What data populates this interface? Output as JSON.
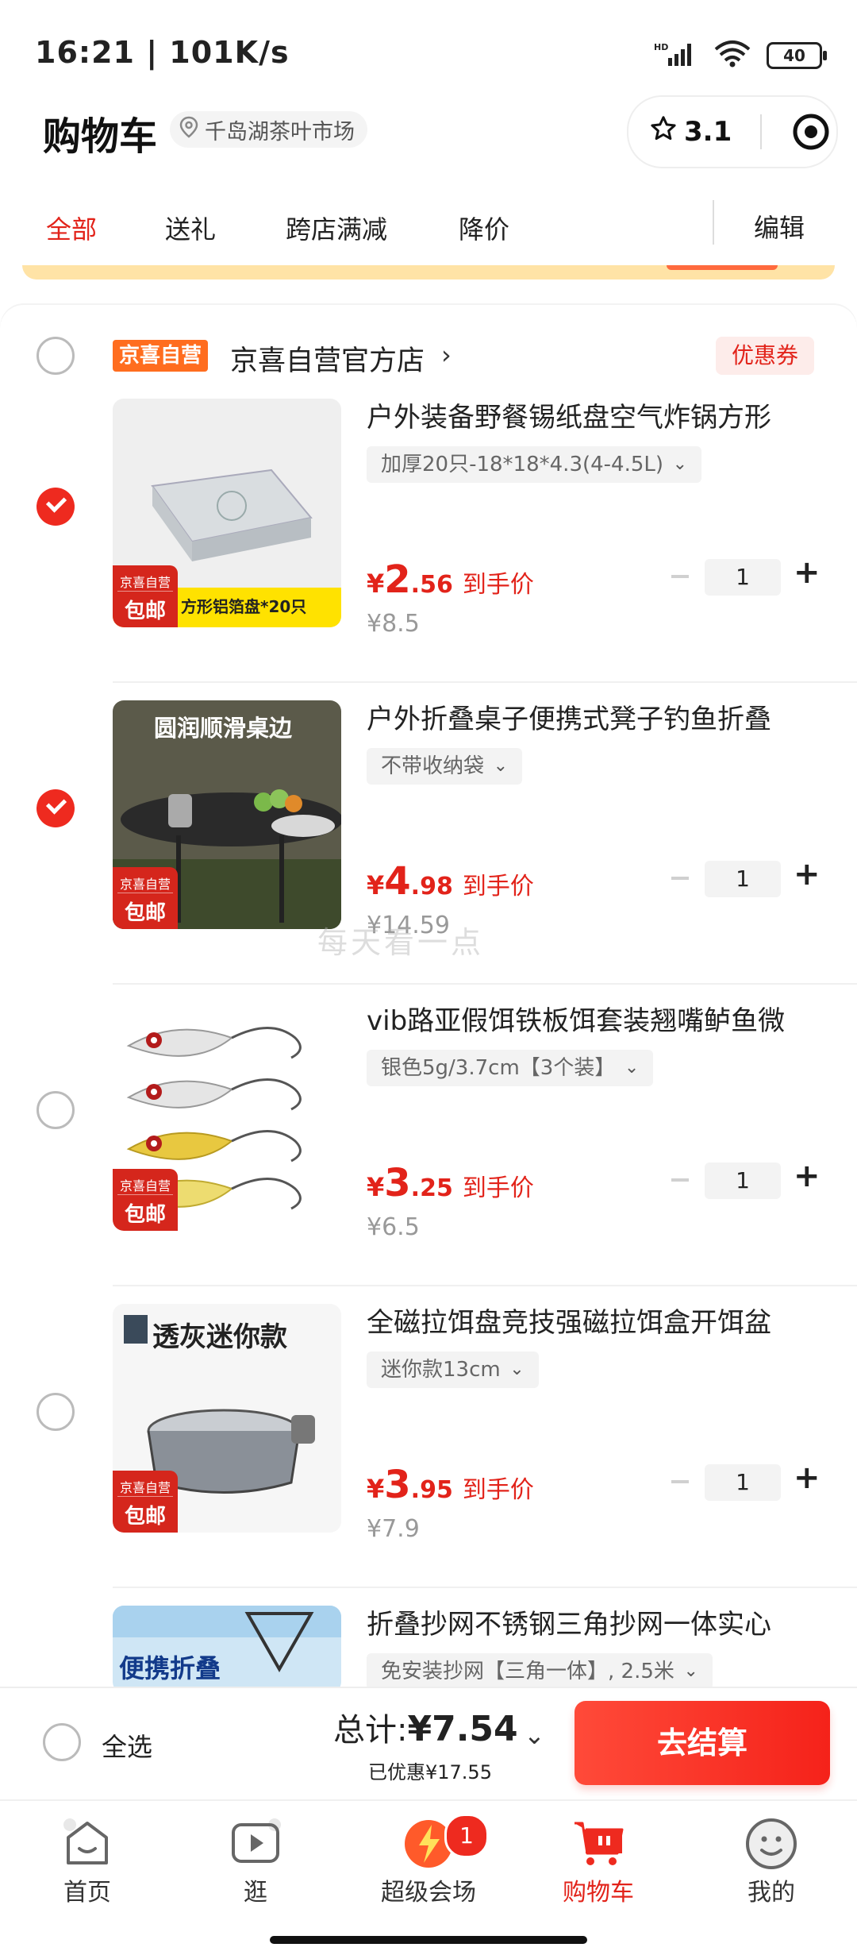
{
  "status_bar": {
    "time": "16:21 | 101K/s",
    "battery": "40"
  },
  "header": {
    "title": "购物车",
    "location": "千岛湖茶叶市场",
    "rating": "3.1"
  },
  "tabs": [
    {
      "label": "全部",
      "active": true
    },
    {
      "label": "送礼",
      "active": false
    },
    {
      "label": "跨店满减",
      "active": false
    },
    {
      "label": "降价",
      "active": false
    }
  ],
  "edit_label": "编辑",
  "shop": {
    "tag": "京喜自营",
    "name": "京喜自营官方店",
    "arrow": "›",
    "coupon_label": "优惠券"
  },
  "badge": {
    "line1": "京喜自营",
    "line2": "包邮"
  },
  "items": [
    {
      "checked": true,
      "title": "户外装备野餐锡纸盘空气炸锅方形",
      "spec": "加厚20只-18*18*4.3(4-4.5L)",
      "currency": "¥",
      "price_int": "2",
      "price_dec": ".56",
      "price_label": "到手价",
      "original_price": "¥8.5",
      "qty": "1",
      "thumb_text": "方形铝箔盘*20只"
    },
    {
      "checked": true,
      "title": "户外折叠桌子便携式凳子钓鱼折叠",
      "spec": "不带收纳袋",
      "currency": "¥",
      "price_int": "4",
      "price_dec": ".98",
      "price_label": "到手价",
      "original_price": "¥14.59",
      "qty": "1",
      "thumb_text": "圆润顺滑桌边"
    },
    {
      "checked": false,
      "title": "vib路亚假饵铁板饵套装翘嘴鲈鱼微",
      "spec": "银色5g/3.7cm【3个装】",
      "currency": "¥",
      "price_int": "3",
      "price_dec": ".25",
      "price_label": "到手价",
      "original_price": "¥6.5",
      "qty": "1",
      "thumb_text": ""
    },
    {
      "checked": false,
      "title": "全磁拉饵盘竞技强磁拉饵盒开饵盆",
      "spec": "迷你款13cm",
      "currency": "¥",
      "price_int": "3",
      "price_dec": ".95",
      "price_label": "到手价",
      "original_price": "¥7.9",
      "qty": "1",
      "thumb_text": "透灰迷你款"
    },
    {
      "checked": false,
      "title": "折叠抄网不锈钢三角抄网一体实心",
      "spec": "免安装抄网【三角一体】, 2.5米",
      "thumb_text": "便携折叠"
    }
  ],
  "watermark": "每天看一点",
  "checkout": {
    "select_all": "全选",
    "total_label": "总计:",
    "total_value": "¥7.54",
    "saved": "已优惠¥17.55",
    "button": "去结算"
  },
  "bottom_nav": [
    {
      "label": "首页",
      "icon": "home-icon",
      "active": false
    },
    {
      "label": "逛",
      "icon": "video-icon",
      "active": false
    },
    {
      "label": "超级会场",
      "icon": "super-venue-icon",
      "active": false
    },
    {
      "label": "购物车",
      "icon": "cart-icon",
      "active": true
    },
    {
      "label": "我的",
      "icon": "profile-icon",
      "active": false
    }
  ],
  "nav_badge": "1",
  "colors": {
    "accent": "#e2231a",
    "self_op_tag": "#ff6d1f",
    "checkbox_checked": "#ee2a1f"
  }
}
